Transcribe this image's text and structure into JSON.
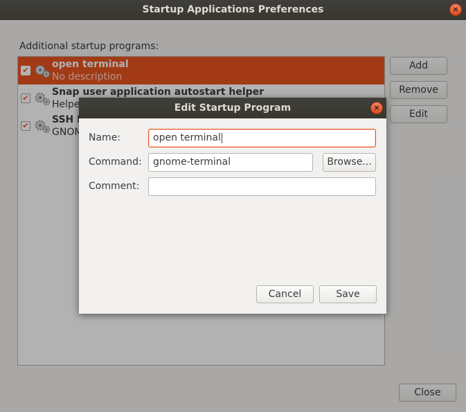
{
  "window": {
    "title": "Startup Applications Preferences",
    "section_label": "Additional startup programs:",
    "close_glyph": "×"
  },
  "programs": [
    {
      "name": "open terminal",
      "description": "No description",
      "checked": true,
      "selected": true
    },
    {
      "name": "Snap user application autostart helper",
      "description": "Helpe",
      "checked": true,
      "selected": false
    },
    {
      "name": "SSH K",
      "description": "GNOM",
      "checked": true,
      "selected": false
    }
  ],
  "side_buttons": {
    "add": "Add",
    "remove": "Remove",
    "edit": "Edit"
  },
  "footer": {
    "close": "Close"
  },
  "dialog": {
    "title": "Edit Startup Program",
    "name_label": "Name:",
    "name_value": "open terminal",
    "command_label": "Command:",
    "command_value": "gnome-terminal",
    "browse": "Browse...",
    "comment_label": "Comment:",
    "comment_value": "",
    "cancel": "Cancel",
    "save": "Save"
  },
  "colors": {
    "accent": "#e95420",
    "titlebar": "#3c3b37",
    "background": "#f2f1f0"
  },
  "icons": {
    "row_icon": "gears-icon",
    "close": "close-icon",
    "check": "checkbox-checked-icon"
  }
}
